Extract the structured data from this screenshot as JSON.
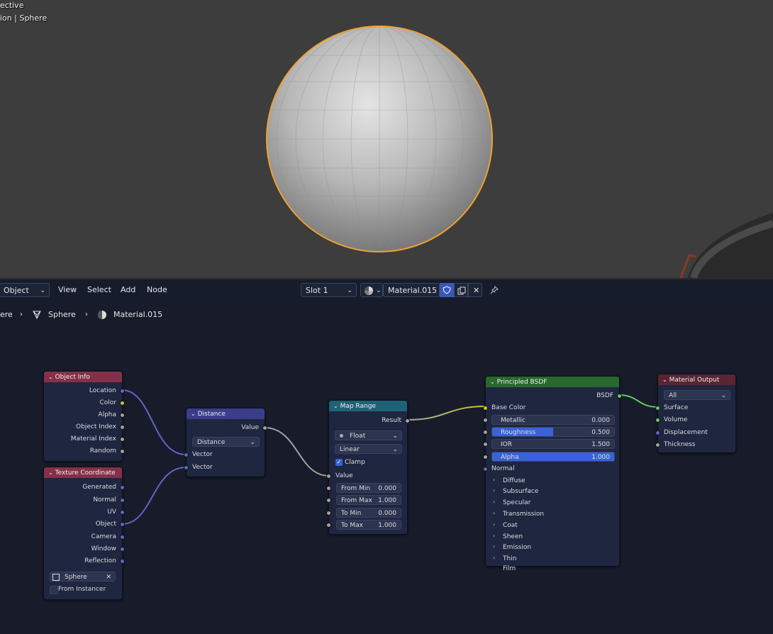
{
  "viewport": {
    "line1": "ective",
    "line2": "ion | Sphere"
  },
  "header": {
    "mode": "Object",
    "menus": [
      "View",
      "Select",
      "Add",
      "Node"
    ],
    "slot": "Slot 1",
    "material": "Material.015"
  },
  "breadcrumb": {
    "first": "ere",
    "object": "Sphere",
    "material": "Material.015"
  },
  "colors": {
    "vector_socket": "#6363c7",
    "color_socket": "#c7c729",
    "float_socket": "#a1a1a1",
    "shader_socket": "#63c763",
    "input_header": "#83314a",
    "converter_header": "#3b3d8a",
    "utility_header": "#1f6277",
    "shader_header": "#28692e",
    "output_header": "#5a2532",
    "accent": "#3a63d9"
  },
  "nodes": {
    "object_info": {
      "title": "Object Info",
      "outputs": [
        "Location",
        "Color",
        "Alpha",
        "Object Index",
        "Material Index",
        "Random"
      ]
    },
    "texture_coordinate": {
      "title": "Texture Coordinate",
      "outputs": [
        "Generated",
        "Normal",
        "UV",
        "Object",
        "Camera",
        "Window",
        "Reflection"
      ],
      "object": "Sphere",
      "from_instancer": "From Instancer"
    },
    "distance": {
      "title": "Distance",
      "output": "Value",
      "operation": "Distance",
      "inputs": [
        "Vector",
        "Vector"
      ]
    },
    "map_range": {
      "title": "Map Range",
      "output": "Result",
      "data_type": "Float",
      "interpolation": "Linear",
      "clamp": "Clamp",
      "value_label": "Value",
      "fields": [
        {
          "label": "From Min",
          "value": "0.000"
        },
        {
          "label": "From Max",
          "value": "1.000"
        },
        {
          "label": "To Min",
          "value": "0.000"
        },
        {
          "label": "To Max",
          "value": "1.000"
        }
      ]
    },
    "principled": {
      "title": "Principled BSDF",
      "output": "BSDF",
      "base_color": "Base Color",
      "fields": [
        {
          "label": "Metallic",
          "value": "0.000",
          "fill": 0
        },
        {
          "label": "Roughness",
          "value": "0.500",
          "fill": 0.5
        },
        {
          "label": "IOR",
          "value": "1.500",
          "fill": 0
        },
        {
          "label": "Alpha",
          "value": "1.000",
          "fill": 1
        }
      ],
      "normal": "Normal",
      "panels": [
        "Diffuse",
        "Subsurface",
        "Specular",
        "Transmission",
        "Coat",
        "Sheen",
        "Emission",
        "Thin Film"
      ]
    },
    "material_output": {
      "title": "Material Output",
      "target": "All",
      "inputs": [
        "Surface",
        "Volume",
        "Displacement",
        "Thickness"
      ]
    }
  }
}
